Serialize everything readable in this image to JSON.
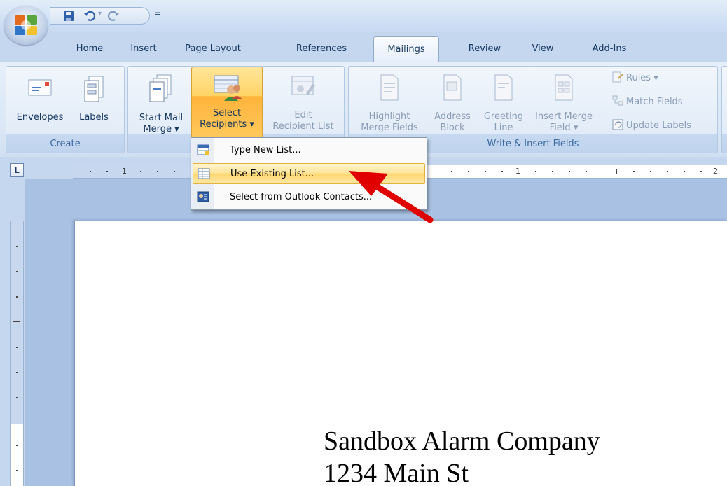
{
  "title_bar": {
    "quick_access": [
      {
        "name": "save-icon"
      },
      {
        "name": "undo-icon"
      },
      {
        "name": "redo-icon"
      }
    ],
    "customize_glyph": "="
  },
  "tabs": [
    {
      "label": "Home",
      "active": false
    },
    {
      "label": "Insert",
      "active": false
    },
    {
      "label": "Page Layout",
      "active": false
    },
    {
      "label": "References",
      "active": false
    },
    {
      "label": "Mailings",
      "active": true
    },
    {
      "label": "Review",
      "active": false
    },
    {
      "label": "View",
      "active": false
    },
    {
      "label": "Add-Ins",
      "active": false
    }
  ],
  "ribbon": {
    "groups": {
      "create": {
        "label": "Create",
        "envelopes": "Envelopes",
        "labels": "Labels"
      },
      "start": {
        "start_mail_merge": [
          "Start Mail",
          "Merge"
        ],
        "select_recipients": [
          "Select",
          "Recipients"
        ],
        "edit_recipient_list": [
          "Edit",
          "Recipient List"
        ]
      },
      "write_insert": {
        "label": "Write & Insert Fields",
        "highlight_merge_fields": [
          "Highlight",
          "Merge Fields"
        ],
        "address_block": [
          "Address",
          "Block"
        ],
        "greeting_line": [
          "Greeting",
          "Line"
        ],
        "insert_merge_field": [
          "Insert Merge",
          "Field"
        ],
        "rules": "Rules",
        "match_fields": "Match Fields",
        "update_labels": "Update Labels"
      }
    },
    "dropdown_glyph": "▾"
  },
  "ruler": {
    "corner_glyph": "L",
    "h_numbers": [
      "1",
      "1",
      "2"
    ]
  },
  "menu": {
    "items": [
      {
        "label": "Type New List...",
        "icon": "new-list-icon",
        "hover": false
      },
      {
        "label": "Use Existing List...",
        "icon": "existing-list-icon",
        "hover": true
      },
      {
        "label": "Select from Outlook Contacts...",
        "icon": "outlook-contacts-icon",
        "hover": false
      }
    ]
  },
  "document": {
    "lines": [
      "Sandbox Alarm Company",
      "1234 Main St"
    ]
  },
  "colors": {
    "accent_orange": "#ffb33b",
    "ribbon_blue": "#dbe7f5",
    "arrow_red": "#e00000"
  }
}
